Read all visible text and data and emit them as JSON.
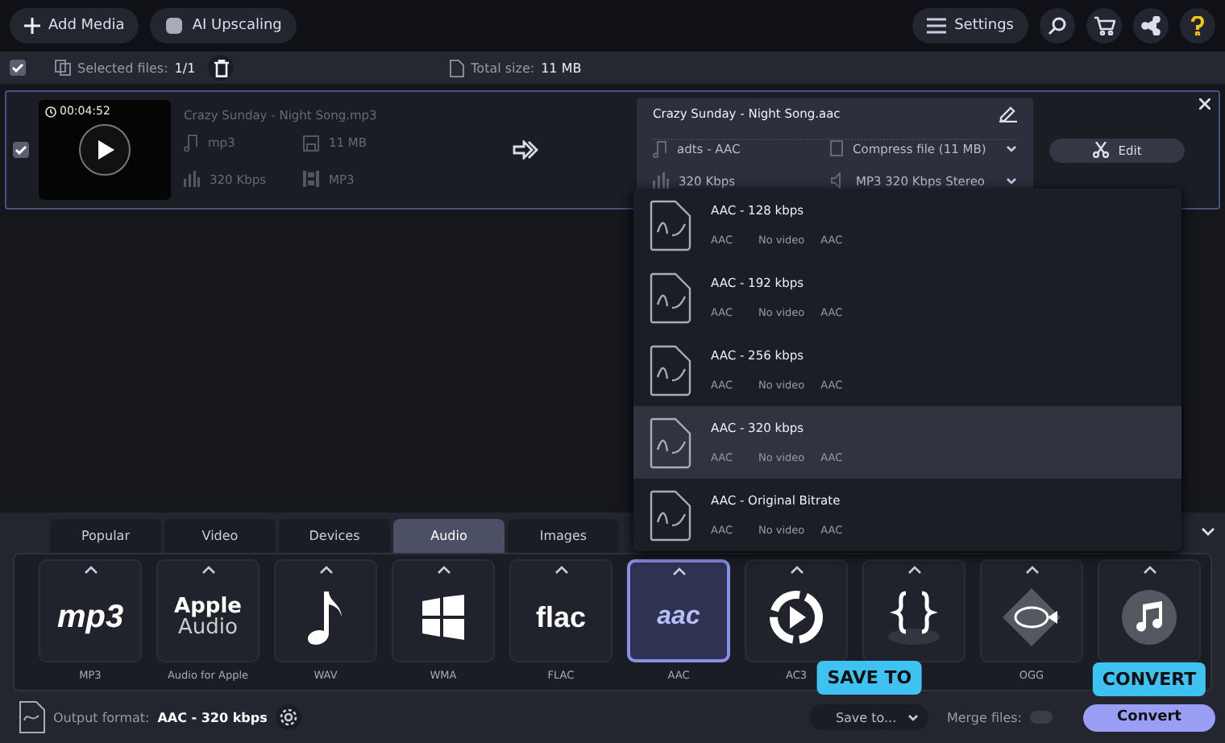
{
  "toolbar": {
    "buttons": [
      {
        "label": "Add Media",
        "kind": "add"
      },
      {
        "label": "AI Upscaling",
        "kind": "ai"
      }
    ],
    "settings": "Settings"
  },
  "selection_bar": {
    "checked": true,
    "selected_label": "Selected files:",
    "selected_count": "1/1",
    "total_label": "Total size:",
    "total_size": "11 MB"
  },
  "file": {
    "checked": true,
    "duration": "00:04:52",
    "name": "Crazy Sunday - Night Song.mp3",
    "format": "mp3",
    "size": "11 MB",
    "bitrate": "320 Kbps",
    "container": "MP3",
    "output": {
      "name": "Crazy Sunday - Night Song.aac",
      "codec": "adts - AAC",
      "compress": "Compress file (11 MB)",
      "bitrate": "320 Kbps",
      "audio": "MP3 320 Kbps Stereo"
    },
    "edit": "Edit"
  },
  "presets": [
    {
      "title": "AAC - 128 kbps",
      "format": "AAC",
      "video": "No video",
      "audio": "AAC",
      "selected": false
    },
    {
      "title": "AAC - 192 kbps",
      "format": "AAC",
      "video": "No video",
      "audio": "AAC",
      "selected": false
    },
    {
      "title": "AAC - 256 kbps",
      "format": "AAC",
      "video": "No video",
      "audio": "AAC",
      "selected": false
    },
    {
      "title": "AAC - 320 kbps",
      "format": "AAC",
      "video": "No video",
      "audio": "AAC",
      "selected": true
    },
    {
      "title": "AAC - Original Bitrate",
      "format": "AAC",
      "video": "No video",
      "audio": "AAC",
      "selected": false
    }
  ],
  "tabs": [
    {
      "label": "Popular",
      "selected": false
    },
    {
      "label": "Video",
      "selected": false
    },
    {
      "label": "Devices",
      "selected": false
    },
    {
      "label": "Audio",
      "selected": true
    },
    {
      "label": "Images",
      "selected": false
    }
  ],
  "formats": [
    {
      "kind": "mp3",
      "logo_text": "mp3",
      "label": "MP3",
      "selected": false
    },
    {
      "kind": "apple",
      "logo_text": "Apple",
      "logo_text_2": "Audio",
      "label": "Audio for Apple",
      "selected": false
    },
    {
      "kind": "note",
      "label": "WAV",
      "selected": false
    },
    {
      "kind": "windows",
      "label": "WMA",
      "selected": false
    },
    {
      "kind": "flac",
      "logo_text": "flac",
      "label": "FLAC",
      "selected": false
    },
    {
      "kind": "aac",
      "logo_text": "aac",
      "label": "AAC",
      "selected": true
    },
    {
      "kind": "ac3",
      "label": "AC3",
      "selected": false
    },
    {
      "kind": "code",
      "selected": false
    },
    {
      "kind": "fish",
      "label": "OGG",
      "selected": false
    },
    {
      "kind": "music",
      "selected": false
    }
  ],
  "output": {
    "label": "Output format:",
    "value": "AAC - 320 kbps"
  },
  "save_to": "Save to...",
  "merge": {
    "label": "Merge files:",
    "on": false
  },
  "convert": "Convert",
  "callouts": [
    "SAVE TO",
    "CONVERT"
  ]
}
